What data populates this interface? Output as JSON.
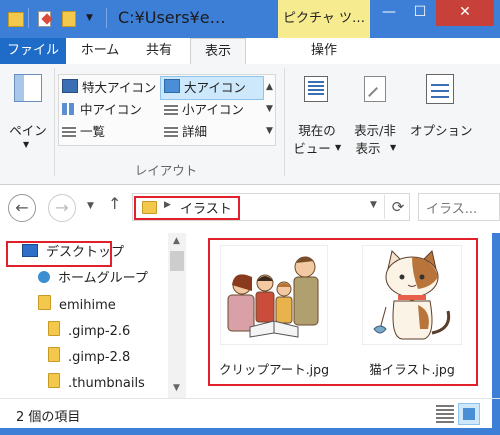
{
  "window": {
    "title": "C:¥Users¥e…",
    "context_tab": "ピクチャ ツ…",
    "minimize_glyph": "—",
    "maximize_glyph": "☐",
    "close_glyph": "✕",
    "frame_color": "#3d7fd6"
  },
  "ribbon_tabs": {
    "file": "ファイル",
    "home": "ホーム",
    "share": "共有",
    "view": "表示",
    "manage": "操作",
    "file_color": "#1e6cc8"
  },
  "ribbon": {
    "pane_label": "ペイン",
    "layout_group": "レイアウト",
    "layout_items": {
      "extra_large": "特大アイコン",
      "large": "大アイコン",
      "medium": "中アイコン",
      "small": "小アイコン",
      "list": "一覧",
      "details": "詳細"
    },
    "current_view_line1": "現在の",
    "current_view_line2": "ビュー",
    "show_hide_line1": "表示/非",
    "show_hide_line2": "表示",
    "options_label": "オプション",
    "selected_item_color": "#cde8fb"
  },
  "address_bar": {
    "path": "イラスト",
    "search_placeholder": "イラス..."
  },
  "nav_tree": [
    {
      "label": "デスクトップ",
      "icon": "desktop-icon"
    },
    {
      "label": "ホームグループ",
      "icon": "homegroup-icon"
    },
    {
      "label": "emihime",
      "icon": "user-folder-icon"
    },
    {
      "label": ".gimp-2.6",
      "icon": "folder-icon"
    },
    {
      "label": ".gimp-2.8",
      "icon": "folder-icon"
    },
    {
      "label": ".thumbnails",
      "icon": "folder-icon"
    }
  ],
  "files": [
    {
      "name": "クリップアート.jpg",
      "thumbnail": "family-clipart"
    },
    {
      "name": "猫イラスト.jpg",
      "thumbnail": "cat-illustration"
    }
  ],
  "status_bar": {
    "item_count": "2 個の項目"
  },
  "highlight_color": "#e0202a"
}
